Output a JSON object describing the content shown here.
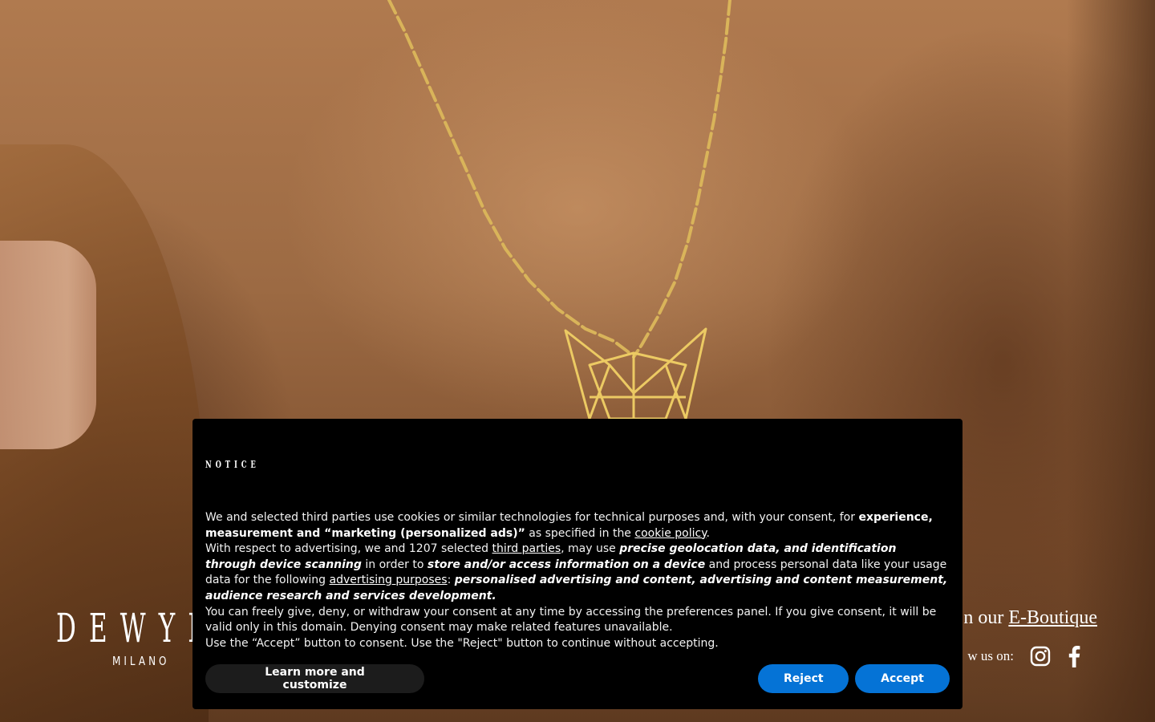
{
  "brand": {
    "logo_main": "DEWYL",
    "logo_sub": "MILANO"
  },
  "footer": {
    "shop_prefix": "n our",
    "shop_link": "E-Boutique",
    "follow_label": "w us on:",
    "social_icons": [
      "instagram-icon",
      "facebook-icon"
    ]
  },
  "consent": {
    "title": "NOTICE",
    "p1": {
      "t1": "We and selected third parties use cookies or similar technologies for technical purposes and, with your consent, for ",
      "b1": "experience, measurement and “marketing (personalized ads)”",
      "t2": " as specified in the ",
      "link1": "cookie policy",
      "t3": "."
    },
    "p2": {
      "t1": "With respect to advertising, we and 1207 selected ",
      "link1": "third parties",
      "t2": ", may use ",
      "bi1": "precise geolocation data, and identification through device scanning",
      "t3": " in order to ",
      "bi2": "store and/or access information on a device",
      "t4": " and process personal data like your usage data for the following ",
      "link2": "advertising purposes",
      "t5": ": ",
      "bi3": "personalised advertising and content, advertising and content measurement, audience research and services development."
    },
    "p3": "You can freely give, deny, or withdraw your consent at any time by accessing the preferences panel. If you give consent, it will be valid only in this domain. Denying consent may make related features unavailable.",
    "p4": "Use the “Accept” button to consent. Use the \"Reject\" button to continue without accepting.",
    "buttons": {
      "learn": "Learn more and customize",
      "reject": "Reject",
      "accept": "Accept"
    },
    "accent_color": "#0573d6"
  },
  "colors": {
    "banner_bg": "#000000",
    "hero_tone": "#9c6a43",
    "gold": "#e6c35c"
  }
}
